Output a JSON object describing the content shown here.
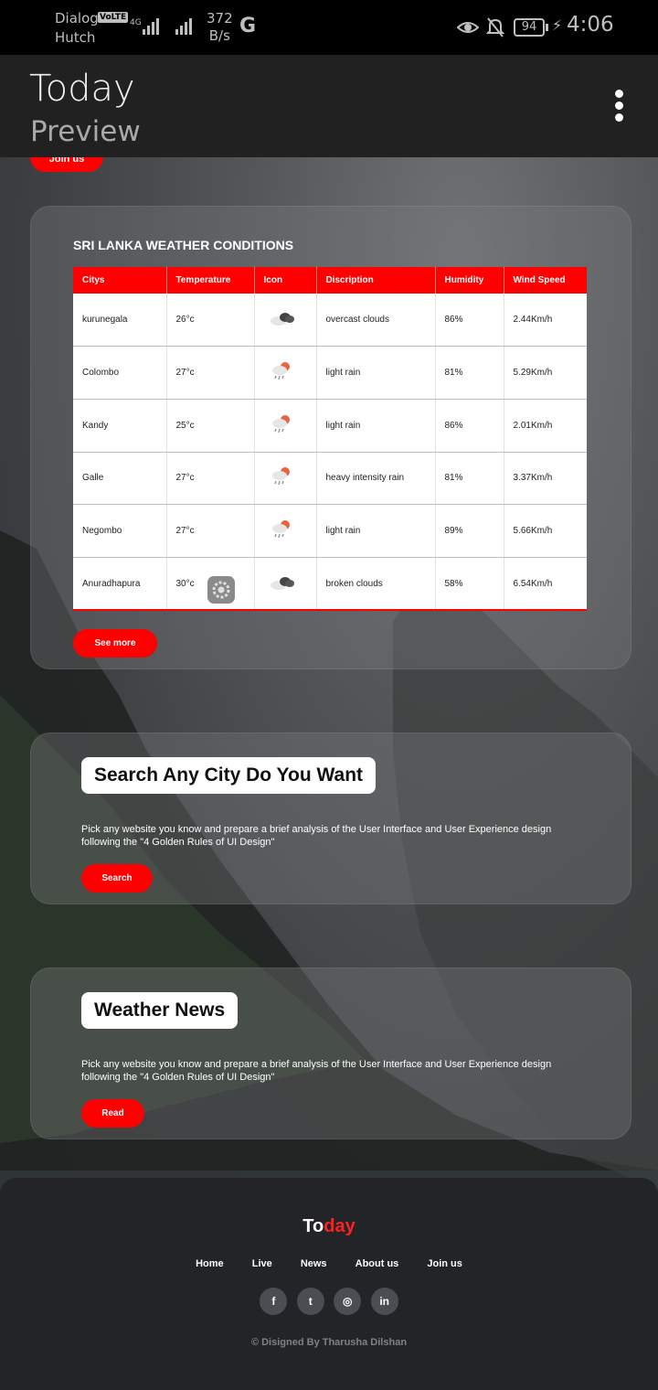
{
  "status_bar": {
    "carrier_line1": "Dialog",
    "volte": "VoLTE",
    "carrier_line2": "Hutch",
    "net_type": "4G",
    "speed_value": "372",
    "speed_unit": "B/s",
    "g_indicator": "G",
    "battery": "94",
    "time": "4:06"
  },
  "app_bar": {
    "title": "Today",
    "subtitle": "Preview",
    "menu_icon": "more-vertical-icon"
  },
  "hero": {
    "join_label": "Join us"
  },
  "weather": {
    "title": "SRI LANKA WEATHER CONDITIONS",
    "columns": [
      "Citys",
      "Temperature",
      "Icon",
      "Discription",
      "Humidity",
      "Wind Speed"
    ],
    "rows": [
      {
        "city": "kurunegala",
        "temp": "26°c",
        "icon": "broken-clouds-icon",
        "desc": "overcast clouds",
        "humidity": "86%",
        "wind": "2.44Km/h"
      },
      {
        "city": "Colombo",
        "temp": "27°c",
        "icon": "light-rain-icon",
        "desc": "light rain",
        "humidity": "81%",
        "wind": "5.29Km/h"
      },
      {
        "city": "Kandy",
        "temp": "25°c",
        "icon": "light-rain-icon",
        "desc": "light rain",
        "humidity": "86%",
        "wind": "2.01Km/h"
      },
      {
        "city": "Galle",
        "temp": "27°c",
        "icon": "light-rain-icon",
        "desc": "heavy intensity rain",
        "humidity": "81%",
        "wind": "3.37Km/h"
      },
      {
        "city": "Negombo",
        "temp": "27°c",
        "icon": "light-rain-icon",
        "desc": "light rain",
        "humidity": "89%",
        "wind": "5.66Km/h"
      },
      {
        "city": "Anuradhapura",
        "temp": "30°c",
        "icon": "broken-clouds-icon",
        "desc": "broken clouds",
        "humidity": "58%",
        "wind": "6.54Km/h"
      }
    ],
    "see_more_label": "See more"
  },
  "search_section": {
    "heading": "Search Any City Do You Want",
    "text": "Pick any website you know and prepare a brief analysis of the User Interface and User Experience design following the \"4 Golden Rules of UI Design\"",
    "button_label": "Search"
  },
  "news_section": {
    "heading": "Weather News",
    "text": "Pick any website you know and prepare a brief analysis of the User Interface and User Experience design following the \"4 Golden Rules of UI Design\"",
    "button_label": "Read"
  },
  "footer": {
    "brand_to": "To",
    "brand_day": "day",
    "nav": [
      "Home",
      "Live",
      "News",
      "About us",
      "Join us"
    ],
    "socials": [
      "facebook-icon",
      "twitter-icon",
      "instagram-icon",
      "linkedin-icon"
    ],
    "social_glyphs": [
      "f",
      "t",
      "◎",
      "in"
    ],
    "copyright": "© Disigned By Tharusha Dilshan"
  },
  "colors": {
    "accent": "#ff0000",
    "header_bg": "#212121",
    "footer_bg": "#222427"
  }
}
